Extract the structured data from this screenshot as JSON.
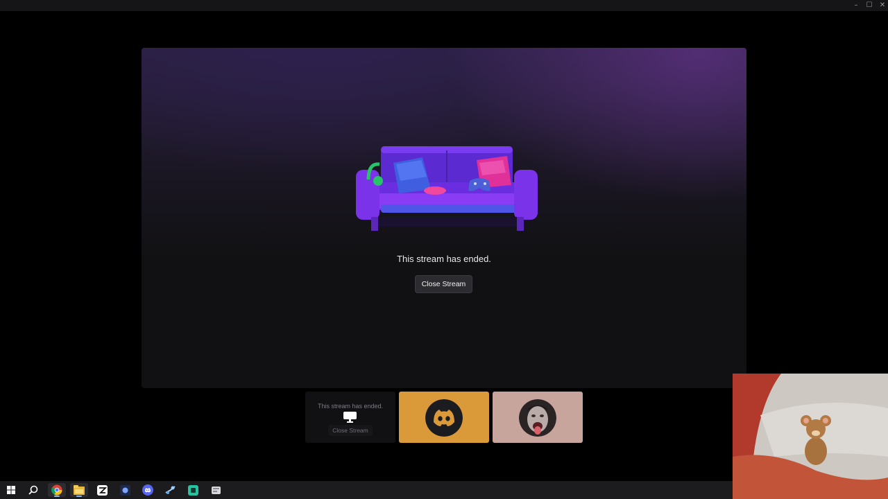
{
  "window": {
    "controls": {
      "minimize": "–",
      "maximize": "☐",
      "close": "✕"
    }
  },
  "stream": {
    "ended_message": "This stream has ended.",
    "close_button_label": "Close Stream"
  },
  "participants": {
    "stream_tile": {
      "ended_message": "This stream has ended.",
      "close_button_label": "Close Stream"
    },
    "discord_tile": {
      "icon": "discord-logo-icon",
      "color": "#db9a3a"
    },
    "user_tile": {
      "icon": "user-avatar",
      "color": "#c8a59c"
    }
  },
  "taskbar": {
    "items": [
      {
        "icon": "windows-start-icon"
      },
      {
        "icon": "search-icon"
      },
      {
        "icon": "chrome-icon"
      },
      {
        "icon": "file-explorer-icon"
      },
      {
        "icon": "capcut-icon"
      },
      {
        "icon": "app-icon"
      },
      {
        "icon": "discord-icon"
      },
      {
        "icon": "steam-icon"
      },
      {
        "icon": "game-app-icon"
      },
      {
        "icon": "app-icon-2"
      }
    ]
  },
  "colors": {
    "background": "#000000",
    "panel": "#111113",
    "panel_glow": "#542e76",
    "discord_tile": "#db9a3a",
    "button": "#2b2b30"
  }
}
